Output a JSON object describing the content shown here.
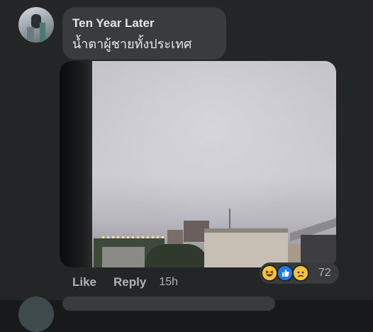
{
  "comment": {
    "author": "Ten Year Later",
    "text": "น้ำตาผู้ชายทั้งประเทศ",
    "timestamp": "15h",
    "reaction_count": "72",
    "reactions": [
      "haha-icon",
      "like-icon",
      "sad-icon"
    ]
  },
  "actions": {
    "like_label": "Like",
    "reply_label": "Reply"
  },
  "colors": {
    "background": "#242526",
    "bubble": "#3a3b3c",
    "text": "#e4e6eb",
    "secondary_text": "#b0b3b8",
    "like_blue": "#1d7ae8",
    "emoji_yellow": "#f7c23c"
  }
}
